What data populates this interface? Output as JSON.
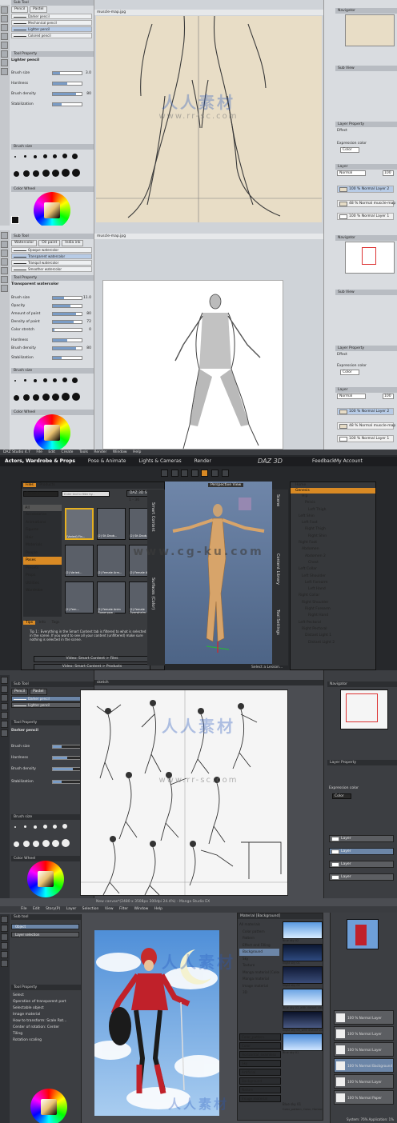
{
  "panel1": {
    "sub_tool_title": "Sub Tool",
    "tabs": [
      "Pencil",
      "Pastel"
    ],
    "brushes": [
      "Darker pencil",
      "Mechanical pencil",
      "Lighter pencil",
      "Colored pencil"
    ],
    "tool_property_title": "Tool Property",
    "tool_name": "Lighter pencil",
    "properties": [
      {
        "label": "Brush size",
        "value": "3.0",
        "level": 0.25
      },
      {
        "label": "Hardness",
        "value": "",
        "level": 0.5
      },
      {
        "label": "Brush density",
        "value": "80",
        "level": 0.8
      },
      {
        "label": "Stabilization",
        "value": "",
        "level": 0.3
      }
    ],
    "brush_size_title": "Brush size",
    "size_labels": [
      "0.7",
      "1",
      "1.5",
      "2",
      "2.5",
      "3",
      "4",
      "5",
      "6",
      "7",
      "8",
      "10",
      "12",
      "15",
      "17",
      "20",
      "25"
    ],
    "color_wheel_title": "Color Wheel",
    "canvas_title": "muscle-map.jpg",
    "navigator_title": "Navigator",
    "sub_view_title": "Sub View",
    "layer_property_title": "Layer Property",
    "effect_label": "Effect",
    "expression_color_label": "Expression color",
    "expression_color_value": "Color",
    "layer_title": "Layer",
    "blend_mode": "Normal",
    "opacity": "100",
    "layers": [
      {
        "name": "100 % Normal Layer 2",
        "selected": true
      },
      {
        "name": "48 % Normal muscle-map",
        "selected": false
      },
      {
        "name": "100 % Normal Layer 1",
        "selected": false
      }
    ]
  },
  "panel2": {
    "sub_tool_title": "Sub Tool",
    "tabs": [
      "Watercolor",
      "Oil paint",
      "India ink"
    ],
    "brushes": [
      "Opaque watercolor",
      "Transparent watercolor",
      "Tranquil watercolor",
      "Smoother watercolor"
    ],
    "tool_property_title": "Tool Property",
    "tool_name": "Transparent watercolor",
    "properties": [
      {
        "label": "Brush size",
        "value": "11.0",
        "level": 0.4
      },
      {
        "label": "Opacity",
        "value": "",
        "level": 0.6
      },
      {
        "label": "Amount of paint",
        "value": "80",
        "level": 0.8
      },
      {
        "label": "Density of paint",
        "value": "72",
        "level": 0.72
      },
      {
        "label": "Color stretch",
        "value": "0",
        "level": 0.05
      },
      {
        "label": "Hardness",
        "value": "",
        "level": 0.5
      },
      {
        "label": "Brush density",
        "value": "80",
        "level": 0.8
      },
      {
        "label": "Stabilization",
        "value": "",
        "level": 0.3
      }
    ],
    "brush_size_title": "Brush size",
    "size_labels": [
      "0.7",
      "1",
      "1.5",
      "2",
      "2.5",
      "3",
      "4",
      "5",
      "6",
      "7",
      "8",
      "10",
      "12",
      "15",
      "17",
      "20",
      "25"
    ],
    "color_wheel_title": "Color Wheel",
    "canvas_title": "muscle-map.jpg",
    "navigator_title": "Navigator",
    "sub_view_title": "Sub View",
    "layer_property_title": "Layer Property",
    "effect_label": "Effect",
    "expression_color_label": "Expression color",
    "expression_color_value": "Color",
    "layer_title": "Layer",
    "blend_mode": "Normal",
    "opacity": "100",
    "layers": [
      {
        "name": "100 % Normal Layer 2",
        "selected": true
      },
      {
        "name": "48 % Normal muscle-map",
        "selected": false
      },
      {
        "name": "100 % Normal Layer 1",
        "selected": false
      }
    ]
  },
  "panel3": {
    "app_title": "DAZ Studio 4.7",
    "menu": [
      "File",
      "Edit",
      "Create",
      "Tools",
      "Render",
      "Window",
      "Help"
    ],
    "top_tabs": [
      "Actors, Wardrobe & Props",
      "Pose & Animate",
      "Lights & Cameras",
      "Render"
    ],
    "logo_text": "DAZ 3D",
    "top_links": [
      "Feedback",
      "My Account"
    ],
    "content_tabs": [
      "Files",
      "Products"
    ],
    "filter_placeholder": "Enter text to filter by...",
    "filter_mode": "Genesis",
    "store_button": "DAZ 3D Store",
    "result_count": "1 - 36",
    "all_label": "All",
    "categories": [
      "Accessories",
      "Animations",
      "Figures",
      "Hair",
      "Materials",
      "People",
      "Poses",
      "Presets",
      "Props",
      "Utilities",
      "Wardrobe"
    ],
    "thumbnails": [
      "(Varied) Fin...",
      "(2) Sit.Doub...",
      "(2) Sit.Doub...",
      "(2) Varied...",
      "(2) Female Arm...",
      "(2) Female Arm...",
      "(2) Fem...",
      "(2) Female Anim Flowerpow...",
      "(2) Female Overwhelm..."
    ],
    "side_tabs": [
      "Smart Content",
      "Parameters",
      "Surfaces (Color)",
      "Content Library",
      "Scene",
      "Tool Settings"
    ],
    "tips_tabs": [
      "Tips",
      "Info",
      "Tags"
    ],
    "tip_text": "Tip 1 : Everything in the Smart Content tab is filtered to what is selected in the scene. If you want to see all your content (unfiltered) make sure nothing is selected in the scene.",
    "tip_buttons": [
      "Video: Smart Content > Files",
      "Video: Smart Content > Products"
    ],
    "viewport_label": "Perspective View",
    "scene_root": "Home",
    "scene_items": [
      "Genesis",
      "Hip",
      "Pelvis",
      "Left Thigh",
      "Left Shin",
      "Left Foot",
      "Right Thigh",
      "Right Shin",
      "Right Foot",
      "Abdomen",
      "Abdomen 2",
      "Chest",
      "Left Collar",
      "Left Shoulder",
      "Left Forearm",
      "Left Hand",
      "Right Collar",
      "Right Shoulder",
      "Right Forearm",
      "Right Hand",
      "Left Pectoral",
      "Right Pectoral",
      "Distant Light 1",
      "Distant Light 2"
    ],
    "lesson_select": "Select a Lesson..."
  },
  "panel4": {
    "sub_tool_title": "Sub Tool",
    "tabs": [
      "Pencil",
      "Pastel"
    ],
    "brushes": [
      "Darker pencil",
      "Lighter pencil"
    ],
    "tool_property_title": "Tool Property",
    "tool_name": "Darker pencil",
    "properties": [
      {
        "label": "Brush size",
        "value": "",
        "level": 0.3
      },
      {
        "label": "Hardness",
        "value": "",
        "level": 0.5
      },
      {
        "label": "Brush density",
        "value": "",
        "level": 0.7
      },
      {
        "label": "Stabilization",
        "value": "",
        "level": 0.3
      }
    ],
    "brush_size_title": "Brush size",
    "color_wheel_title": "Color Wheel",
    "canvas_title": "sketch",
    "navigator_title": "Navigator",
    "layer_property_title": "Layer Property",
    "expression_color_label": "Expression color",
    "expression_color_value": "Color",
    "layers": [
      {
        "name": "Layer",
        "selected": false
      },
      {
        "name": "Layer",
        "selected": true
      },
      {
        "name": "Layer",
        "selected": false
      },
      {
        "name": "Layer",
        "selected": false
      }
    ]
  },
  "panel5": {
    "menu": [
      "File",
      "Edit",
      "Story(P)",
      "Layer",
      "Selection",
      "View",
      "Filter",
      "Window",
      "Help"
    ],
    "window_title": "New canvas*(2480 x 3508px 300dpi 24.4%) - Manga Studio EX",
    "sub_tool_title": "Sub tool",
    "object_label": "Object",
    "layer_selection_label": "Layer selection",
    "tool_property_title": "Tool Property",
    "operation_items": [
      "Select",
      "Operation of transparent part",
      "Selectable object",
      "Image material",
      "How to transform: Scale Rot...",
      "Center of rotation: Center",
      "Tiling",
      "Rotation scaling"
    ],
    "material_title": "Material [Background]",
    "material_tree": [
      "All materials",
      "Color pattern",
      "Pattern",
      "Effect and Filling",
      "Background",
      "Sky",
      "Texture",
      "Manga material [Color]",
      "Manga material",
      "Image material",
      "3D"
    ],
    "material_thumbs": [
      "Blue sky 02",
      "Night sky 01",
      "Night sky 02",
      "Blue sky 03_with distant view",
      "Night sky 05_with distant view",
      "Blue sky 01"
    ],
    "tags": [
      "Color_pattern",
      "Color",
      "Horizontal_seamless",
      "Sky",
      "Artificial",
      "Background",
      "Nature",
      "Image material"
    ],
    "material_detail": "Blue sky 01",
    "material_tags_line": "Color_pattern, Color, Horizontal_seaml...",
    "status_text": "System: 76%  Application: 1%",
    "layer_items": [
      "100 % Normal Layer",
      "100 % Normal Layer",
      "100 % Normal Layer",
      "100 % Normal Background",
      "100 % Normal Layer",
      "100 % Normal Paper"
    ]
  },
  "watermark": {
    "text": "人人素材",
    "url": "www.rr-sc.com",
    "text2": "www.cg-ku.com"
  }
}
